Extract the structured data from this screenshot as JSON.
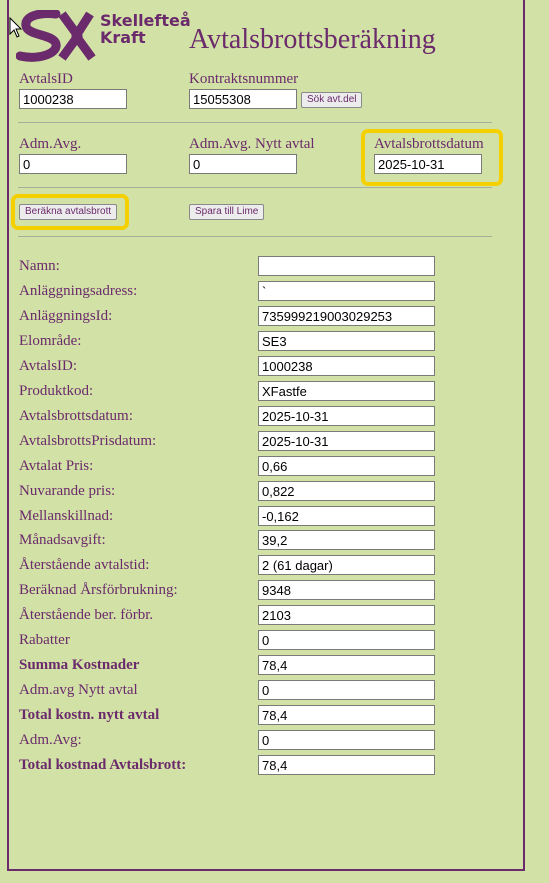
{
  "logo": {
    "line1": "Skellefteå",
    "line2": "Kraft"
  },
  "page_title": "Avtalsbrottsberäkning",
  "lookup": {
    "avtalsid_label": "AvtalsID",
    "avtalsid_value": "1000238",
    "kontrakt_label": "Kontraktsnummer",
    "kontrakt_value": "15055308",
    "search_button": "Sök avt.del"
  },
  "params": {
    "adm_avg_label": "Adm.Avg.",
    "adm_avg_value": "0",
    "adm_avg_nytt_label": "Adm.Avg. Nytt avtal",
    "adm_avg_nytt_value": "0",
    "avtalsbrottsdatum_label": "Avtalsbrottsdatum",
    "avtalsbrottsdatum_value": "2025-10-31"
  },
  "actions": {
    "calculate_button": "Beräkna avtalsbrott",
    "save_button": "Spara till Lime"
  },
  "results": [
    {
      "label": "Namn:",
      "value": "",
      "bold": false
    },
    {
      "label": "Anläggningsadress:",
      "value": "`",
      "bold": false
    },
    {
      "label": "AnläggningsId:",
      "value": "735999219003029253",
      "bold": false
    },
    {
      "label": "Elområde:",
      "value": "SE3",
      "bold": false
    },
    {
      "label": "AvtalsID:",
      "value": "1000238",
      "bold": false
    },
    {
      "label": "Produktkod:",
      "value": "XFastfe",
      "bold": false
    },
    {
      "label": "Avtalsbrottsdatum:",
      "value": "2025-10-31",
      "bold": false
    },
    {
      "label": "AvtalsbrottsPrisdatum:",
      "value": "2025-10-31",
      "bold": false
    },
    {
      "label": "Avtalat Pris:",
      "value": "0,66",
      "bold": false
    },
    {
      "label": "Nuvarande pris:",
      "value": "0,822",
      "bold": false
    },
    {
      "label": "Mellanskillnad:",
      "value": "-0,162",
      "bold": false
    },
    {
      "label": "Månadsavgift:",
      "value": "39,2",
      "bold": false
    },
    {
      "label": "Återstående avtalstid:",
      "value": "2 (61 dagar)",
      "bold": false
    },
    {
      "label": "Beräknad Årsförbrukning:",
      "value": "9348",
      "bold": false
    },
    {
      "label": "Återstående ber. förbr.",
      "value": "2103",
      "bold": false
    },
    {
      "label": "Rabatter",
      "value": "0",
      "bold": false
    },
    {
      "label": "Summa Kostnader",
      "value": "78,4",
      "bold": true
    },
    {
      "label": "Adm.avg Nytt avtal",
      "value": "0",
      "bold": false
    },
    {
      "label": "Total kostn. nytt avtal",
      "value": "78,4",
      "bold": true
    },
    {
      "label": "Adm.Avg:",
      "value": "0",
      "bold": false
    },
    {
      "label": "Total kostnad Avtalsbrott:",
      "value": "78,4",
      "bold": true
    }
  ],
  "colors": {
    "background": "#d2e2a6",
    "brand": "#6b2a6b",
    "highlight": "#f5d000"
  }
}
